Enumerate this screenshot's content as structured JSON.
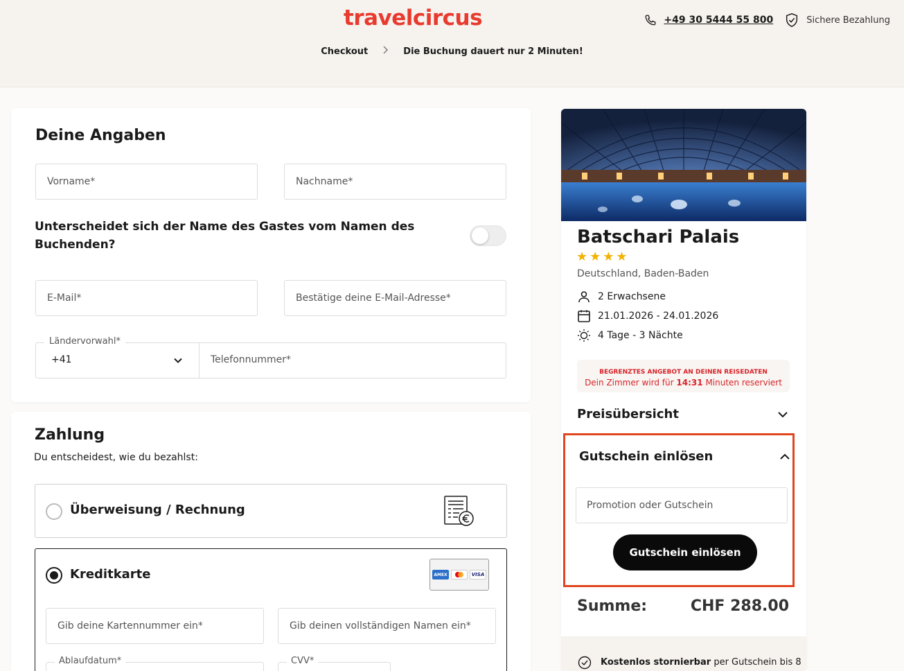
{
  "header": {
    "logo": "travelcircus",
    "phone": "+49 30 5444 55 800",
    "secure_label": "Sichere Bezahlung",
    "breadcrumb": [
      "Checkout",
      "Die Buchung dauert nur 2 Minuten!"
    ]
  },
  "details": {
    "title": "Deine Angaben",
    "first_name_placeholder": "Vorname*",
    "last_name_placeholder": "Nachname*",
    "guest_question": "Unterscheidet sich der Name des Gastes vom Namen des Buchenden?",
    "toggle_on": false,
    "email_placeholder": "E-Mail*",
    "email_confirm_placeholder": "Bestätige deine E-Mail-Adresse*",
    "country_code_label": "Ländervorwahl*",
    "country_code_value": "+41",
    "phone_placeholder": "Telefonnummer*"
  },
  "payment": {
    "title": "Zahlung",
    "subtitle": "Du entscheidest, wie du bezahlst:",
    "option_transfer": "Überweisung / Rechnung",
    "option_card": "Kreditkarte",
    "selected": "Kreditkarte",
    "card_number_placeholder": "Gib deine Kartennummer ein*",
    "card_name_placeholder": "Gib deinen vollständigen Namen ein*",
    "expiry_label": "Ablaufdatum*",
    "cvv_label": "CVV*",
    "card_brands": [
      "AMERICAN EXPRESS",
      "Mastercard",
      "VISA"
    ]
  },
  "hotel": {
    "name": "Batschari Palais",
    "stars": 4,
    "location": "Deutschland, Baden-Baden",
    "guests": "2 Erwachsene",
    "dates": "21.01.2026 - 24.01.2026",
    "duration": "4 Tage - 3 Nächte"
  },
  "offer": {
    "headline": "BEGRENZTES ANGEBOT AN DEINEN REISEDATEN",
    "text_before": "Dein Zimmer wird für",
    "time": "14:31",
    "text_after": "Minuten reserviert"
  },
  "summary": {
    "price_overview": "Preisübersicht",
    "coupon_title": "Gutschein einlösen",
    "coupon_placeholder": "Promotion oder Gutschein",
    "coupon_button": "Gutschein einlösen",
    "total_label": "Summe:",
    "total_value": "CHF 288.00",
    "free_cancel_bold": "Kostenlos stornierbar",
    "free_cancel_rest": "per Gutschein bis 8"
  },
  "colors": {
    "brand": "#e83a2e",
    "highlight_border": "#e0451f",
    "star": "#f3b100",
    "alert_text": "#d8232a"
  }
}
